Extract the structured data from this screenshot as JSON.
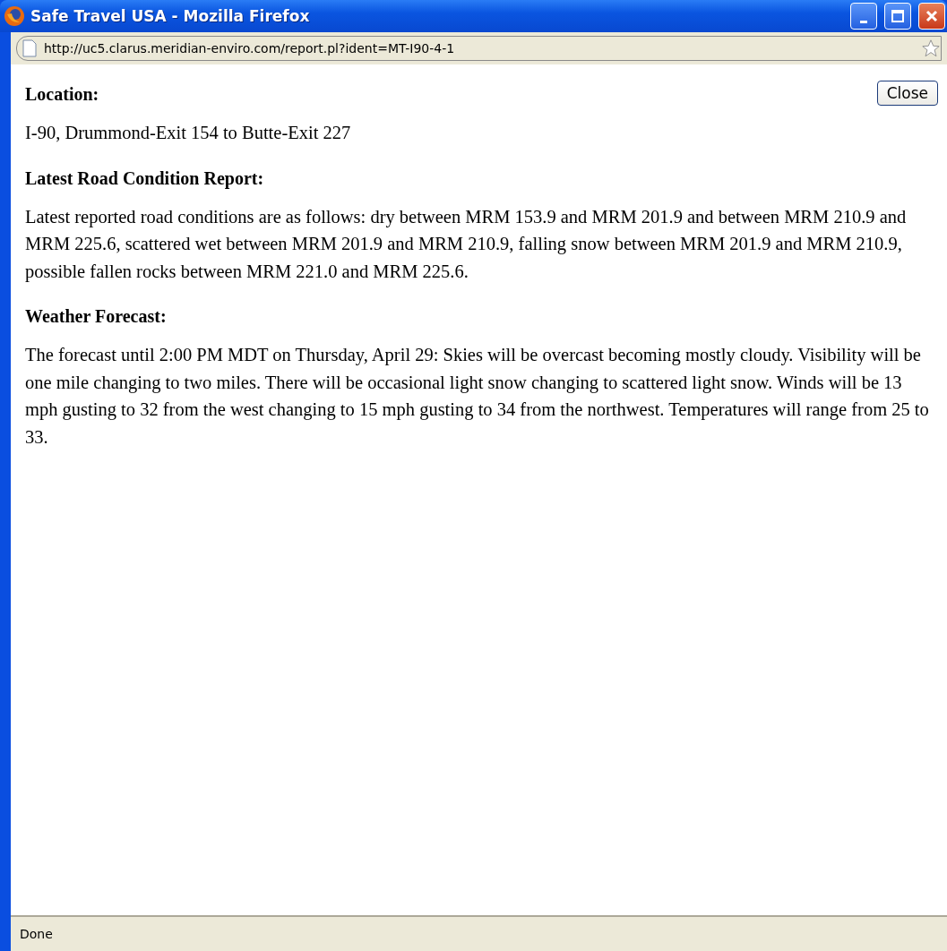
{
  "window": {
    "title": "Safe Travel USA - Mozilla Firefox"
  },
  "address_bar": {
    "url": "http://uc5.clarus.meridian-enviro.com/report.pl?ident=MT-I90-4-1"
  },
  "close_button": "Close",
  "sections": [
    {
      "heading": "Location:",
      "body": "I-90, Drummond-Exit 154 to Butte-Exit 227"
    },
    {
      "heading": "Latest Road Condition Report:",
      "body": "Latest reported road conditions are as follows: dry between MRM 153.9 and MRM 201.9 and between MRM 210.9 and MRM 225.6, scattered wet between MRM 201.9 and MRM 210.9, falling snow between MRM 201.9 and MRM 210.9, possible fallen rocks between MRM 221.0 and MRM 225.6."
    },
    {
      "heading": "Weather Forecast:",
      "body": "The forecast until 2:00 PM MDT on Thursday, April 29: Skies will be overcast becoming mostly cloudy. Visibility will be one mile changing to two miles. There will be occasional light snow changing to scattered light snow. Winds will be 13 mph gusting to 32 from the west changing to 15 mph gusting to 34 from the northwest. Temperatures will range from 25 to 33."
    }
  ],
  "status_bar": {
    "text": "Done"
  }
}
